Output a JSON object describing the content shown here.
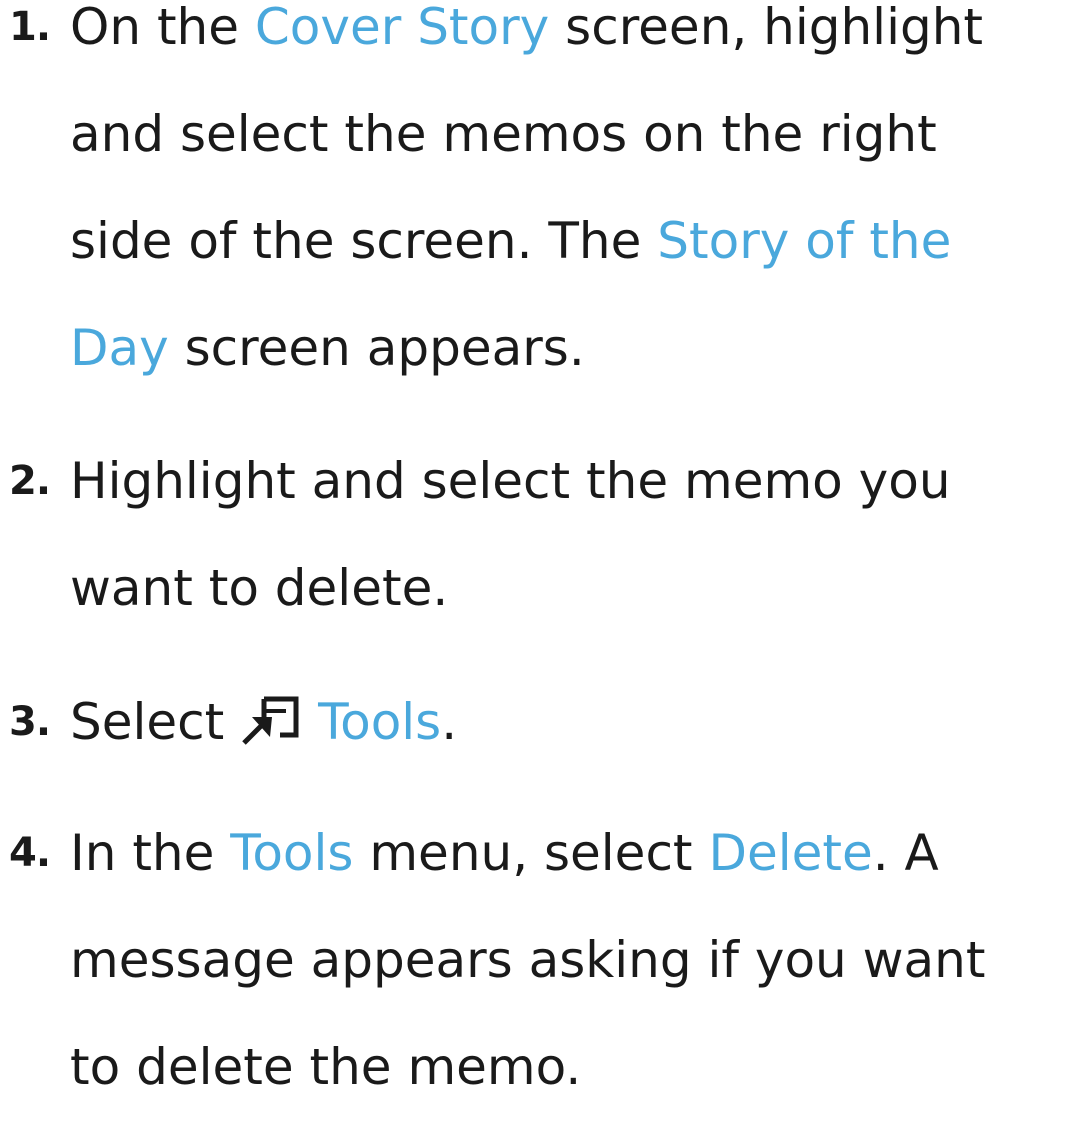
{
  "colors": {
    "text": "#1a1a1a",
    "highlight": "#4aa8dc"
  },
  "steps": [
    {
      "number": "1.",
      "lines": [
        [
          "On the ",
          "Cover Story",
          " screen, highlight"
        ],
        [
          "and select the memos on the right"
        ],
        [
          "side of the screen. The ",
          "Story of the"
        ],
        [
          "Day",
          " screen appears."
        ]
      ]
    },
    {
      "number": "2.",
      "lines": [
        [
          "Highlight and select the memo you"
        ],
        [
          "want to delete."
        ]
      ]
    },
    {
      "number": "3.",
      "lines": [
        [
          "Select ",
          "Tools",
          "."
        ]
      ],
      "icon": "tools-remote-icon"
    },
    {
      "number": "4.",
      "lines": [
        [
          "In the ",
          "Tools",
          " menu, select ",
          "Delete",
          ". A"
        ],
        [
          "message appears asking if you want"
        ],
        [
          "to delete the memo."
        ]
      ]
    }
  ]
}
